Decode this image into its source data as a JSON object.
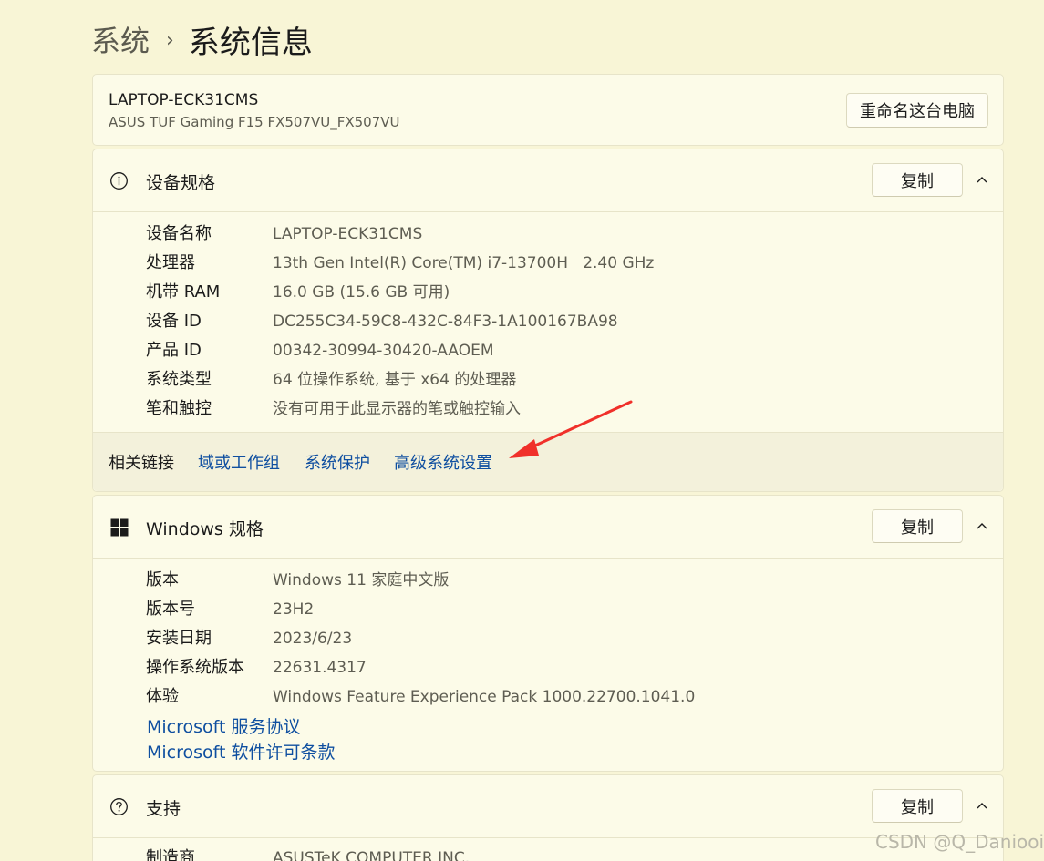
{
  "breadcrumb": {
    "parent": "系统",
    "separator": "›",
    "current": "系统信息"
  },
  "device": {
    "name": "LAPTOP-ECK31CMS",
    "model": "ASUS TUF Gaming F15 FX507VU_FX507VU",
    "rename_label": "重命名这台电脑"
  },
  "device_specs": {
    "title": "设备规格",
    "copy_label": "复制",
    "icon": "info-icon",
    "rows": [
      {
        "label": "设备名称",
        "value": "LAPTOP-ECK31CMS"
      },
      {
        "label": "处理器",
        "value": "13th Gen Intel(R) Core(TM) i7-13700H   2.40 GHz"
      },
      {
        "label": "机带 RAM",
        "value": "16.0 GB (15.6 GB 可用)"
      },
      {
        "label": "设备 ID",
        "value": "DC255C34-59C8-432C-84F3-1A100167BA98"
      },
      {
        "label": "产品 ID",
        "value": "00342-30994-30420-AAOEM"
      },
      {
        "label": "系统类型",
        "value": "64 位操作系统, 基于 x64 的处理器"
      },
      {
        "label": "笔和触控",
        "value": "没有可用于此显示器的笔或触控输入"
      }
    ]
  },
  "related_links": {
    "label": "相关链接",
    "links": [
      "域或工作组",
      "系统保护",
      "高级系统设置"
    ]
  },
  "windows_specs": {
    "title": "Windows 规格",
    "copy_label": "复制",
    "icon": "windows-logo-icon",
    "rows": [
      {
        "label": "版本",
        "value": "Windows 11 家庭中文版"
      },
      {
        "label": "版本号",
        "value": "23H2"
      },
      {
        "label": "安装日期",
        "value": "2023/6/23"
      },
      {
        "label": "操作系统版本",
        "value": "22631.4317"
      },
      {
        "label": "体验",
        "value": "Windows Feature Experience Pack 1000.22700.1041.0"
      }
    ],
    "links": [
      "Microsoft 服务协议",
      "Microsoft 软件许可条款"
    ]
  },
  "support": {
    "title": "支持",
    "copy_label": "复制",
    "icon": "help-icon",
    "rows": [
      {
        "label": "制造商",
        "value": "ASUSTeK COMPUTER INC."
      }
    ]
  },
  "annotation": {
    "color": "#f0302a"
  },
  "watermark": "CSDN @Q_Daniooi"
}
